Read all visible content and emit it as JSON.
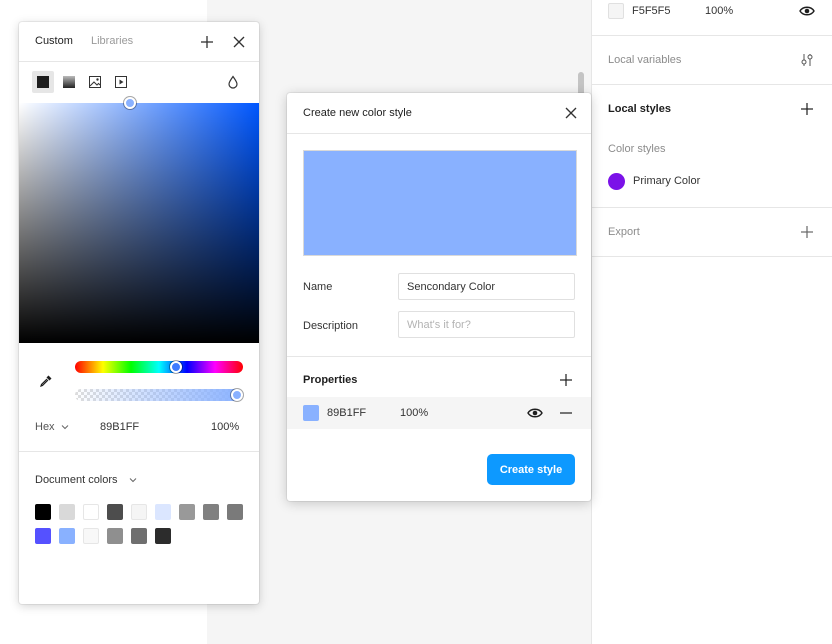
{
  "colors": {
    "accent": "#0d99ff",
    "selected_color": "#89b1ff",
    "primary_color": "#7b12e8"
  },
  "right_panel": {
    "fill_row": {
      "hex": "F5F5F5",
      "opacity": "100%",
      "visibility_icon": "eye-icon"
    },
    "local_variables": {
      "label": "Local variables",
      "icon": "sliders-icon"
    },
    "local_styles": {
      "label": "Local styles",
      "icon": "plus-icon"
    },
    "color_styles_label": "Color styles",
    "styles": [
      {
        "name": "Primary Color",
        "color": "#7b12e8"
      }
    ],
    "export": {
      "label": "Export",
      "icon": "plus-icon"
    }
  },
  "color_picker": {
    "tabs": [
      {
        "label": "Custom",
        "active": true
      },
      {
        "label": "Libraries",
        "active": false
      }
    ],
    "modes": [
      "solid-fill-icon",
      "gradient-icon",
      "image-icon",
      "video-icon"
    ],
    "blend_icon": "drop-icon",
    "format_label": "Hex",
    "hex_value": "89B1FF",
    "opacity": "100%",
    "document_colors_label": "Document colors",
    "document_colors": [
      "#000000",
      "#d9d9d9",
      "#ffffff",
      "#4d4d4d",
      "#f5f5f5",
      "#dbe6ff",
      "#999999",
      "#808080",
      "#7a7a7a",
      "#5551ff",
      "#89b1ff",
      "#f8f8f8",
      "#8f8f8f",
      "#6f6f6f",
      "#2c2c2c"
    ]
  },
  "modal": {
    "title": "Create new color style",
    "name_label": "Name",
    "name_value": "Sencondary Color",
    "description_label": "Description",
    "description_placeholder": "What's it for?",
    "properties_label": "Properties",
    "property": {
      "hex": "89B1FF",
      "opacity": "100%"
    },
    "create_label": "Create style"
  }
}
